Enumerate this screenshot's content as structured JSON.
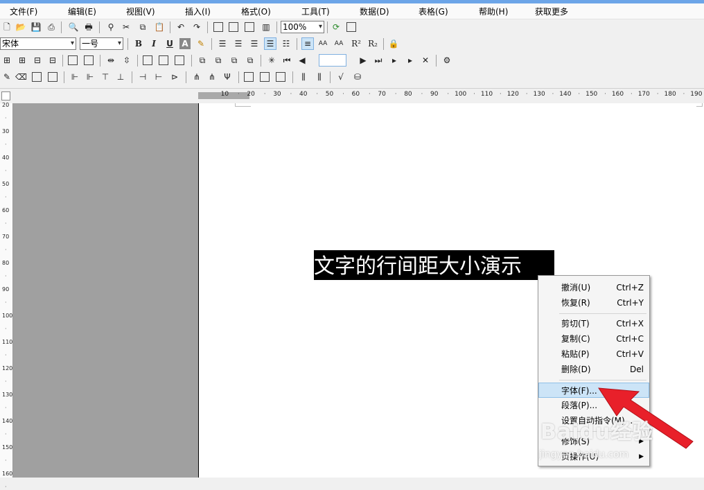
{
  "menubar": {
    "items": [
      "文件(F)",
      "编辑(E)",
      "视图(V)",
      "插入(I)",
      "格式(O)",
      "工具(T)",
      "数据(D)",
      "表格(G)",
      "帮助(H)",
      "获取更多"
    ]
  },
  "toolbar1": {
    "zoom": "100%"
  },
  "toolbar2": {
    "font_name": "宋体",
    "font_size": "一号",
    "bold": "B",
    "italic": "I",
    "underline": "U",
    "superscript": "R²",
    "subscript": "R₂"
  },
  "ruler": {
    "h_labels": [
      "10",
      "20",
      "30",
      "40",
      "50",
      "60",
      "70",
      "80",
      "90",
      "100",
      "110",
      "120",
      "130",
      "140",
      "150",
      "160",
      "170",
      "180",
      "190"
    ],
    "v_labels": [
      "20",
      "30",
      "40",
      "50",
      "60",
      "70",
      "80",
      "90",
      "100",
      "110",
      "120",
      "130",
      "140",
      "150",
      "160"
    ]
  },
  "document": {
    "selected_text": "文字的行间距大小演示"
  },
  "context_menu": {
    "items": [
      {
        "label": "撤消(U)",
        "shortcut": "Ctrl+Z"
      },
      {
        "label": "恢复(R)",
        "shortcut": "Ctrl+Y"
      },
      {
        "label": "剪切(T)",
        "shortcut": "Ctrl+X"
      },
      {
        "label": "复制(C)",
        "shortcut": "Ctrl+C"
      },
      {
        "label": "粘贴(P)",
        "shortcut": "Ctrl+V"
      },
      {
        "label": "删除(D)",
        "shortcut": "Del"
      },
      {
        "label": "字体(F)...",
        "shortcut": ""
      },
      {
        "label": "段落(P)...",
        "shortcut": ""
      },
      {
        "label": "设置自动指令(M)...",
        "shortcut": ""
      },
      {
        "label": "修饰(S)",
        "shortcut": ""
      },
      {
        "label": "页操作(U)",
        "shortcut": ""
      }
    ],
    "highlighted": "字体(F)..."
  },
  "watermark": {
    "logo": "Baidu经验",
    "url": "jingyan.baidu.com"
  },
  "colors": {
    "arrow": "#e8202a",
    "highlight": "#cce4f7",
    "title_strip": "#6ca5e8"
  }
}
